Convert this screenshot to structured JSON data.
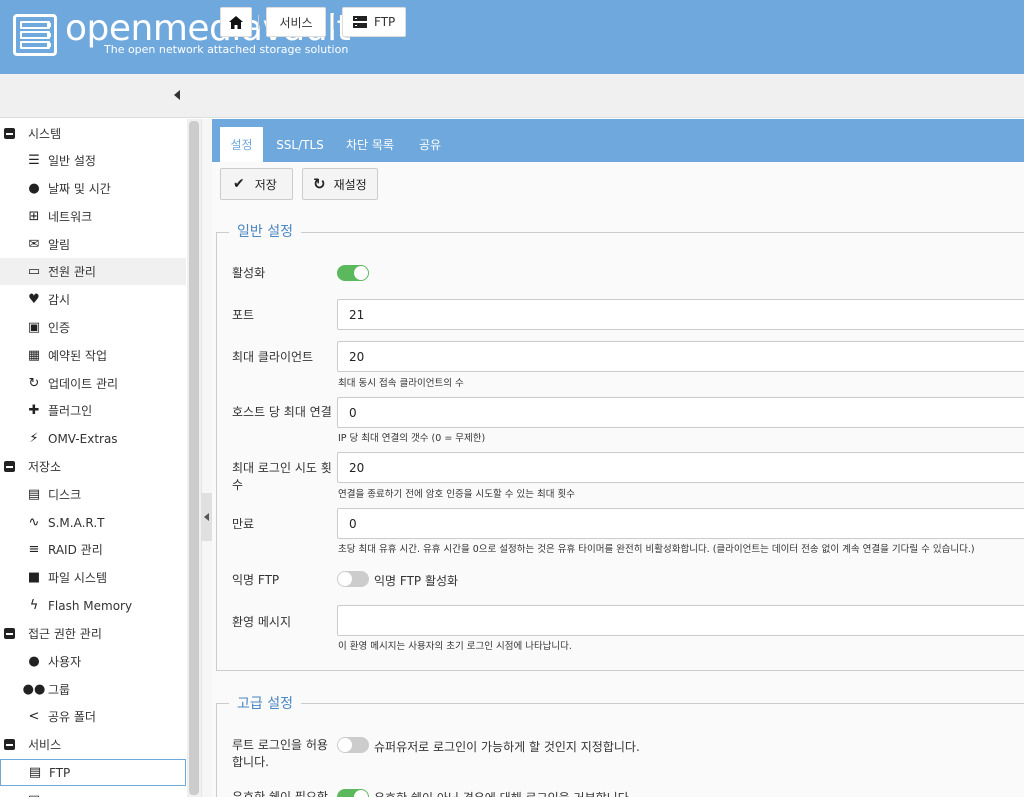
{
  "header": {
    "logo_text": "openmediavault",
    "tagline": "The open network attached storage solution"
  },
  "breadcrumb": {
    "services": "서비스",
    "ftp": "FTP"
  },
  "sidebar": {
    "groups": [
      {
        "label": "시스템"
      },
      {
        "label": "저장소"
      },
      {
        "label": "접근 권한 관리"
      },
      {
        "label": "서비스"
      }
    ],
    "items": [
      {
        "label": "일반 설정",
        "icon": "sliders-icon"
      },
      {
        "label": "날짜 및 시간",
        "icon": "clock-icon"
      },
      {
        "label": "네트워크",
        "icon": "network-icon"
      },
      {
        "label": "알림",
        "icon": "mail-icon"
      },
      {
        "label": "전원 관리",
        "icon": "battery-icon"
      },
      {
        "label": "감시",
        "icon": "heartbeat-icon"
      },
      {
        "label": "인증",
        "icon": "certificate-icon"
      },
      {
        "label": "예약된 작업",
        "icon": "calendar-clock-icon"
      },
      {
        "label": "업데이트 관리",
        "icon": "refresh-icon"
      },
      {
        "label": "플러그인",
        "icon": "puzzle-icon"
      },
      {
        "label": "OMV-Extras",
        "icon": "plug-icon"
      },
      {
        "label": "디스크",
        "icon": "disk-icon"
      },
      {
        "label": "S.M.A.R.T",
        "icon": "pulse-icon"
      },
      {
        "label": "RAID 관리",
        "icon": "database-icon"
      },
      {
        "label": "파일 시스템",
        "icon": "folder-stack-icon"
      },
      {
        "label": "Flash Memory",
        "icon": "lightning-icon"
      },
      {
        "label": "사용자",
        "icon": "user-icon"
      },
      {
        "label": "그룹",
        "icon": "group-icon"
      },
      {
        "label": "공유 폴더",
        "icon": "share-icon"
      },
      {
        "label": "FTP",
        "icon": "server-icon"
      }
    ]
  },
  "tabs": [
    "설정",
    "SSL/TLS",
    "차단 목록",
    "공유"
  ],
  "buttons": {
    "save": "저장",
    "reset": "재설정"
  },
  "general": {
    "legend": "일반 설정",
    "enable_label": "활성화",
    "enable_on": true,
    "port_label": "포트",
    "port_value": "21",
    "max_clients_label": "최대 클라이언트",
    "max_clients_value": "20",
    "max_clients_hint": "최대 동시 접속 클라이언트의 수",
    "max_per_host_label": "호스트 당 최대 연결",
    "max_per_host_value": "0",
    "max_per_host_hint": "IP 당 최대 연결의 갯수 (0 = 무제한)",
    "max_login_label": "최대 로그인 시도 횟수",
    "max_login_value": "20",
    "max_login_hint": "연결을 종료하기 전에 암호 인증을 시도할 수 있는 최대 횟수",
    "timeout_label": "만료",
    "timeout_value": "0",
    "timeout_hint": "초당 최대 유휴 시간. 유휴 시간을 0으로 설정하는 것은 유휴 타이머를 완전히 비활성화합니다. (클라이언트는 데이터 전송 없이 계속 연결을 기다릴 수 있습니다.)",
    "anon_label": "익명 FTP",
    "anon_toggle_label": "익명 FTP 활성화",
    "anon_on": false,
    "welcome_label": "환영 메시지",
    "welcome_value": "",
    "welcome_hint": "이 환영 메시지는 사용자의 초기 로그인 시점에 나타납니다."
  },
  "advanced": {
    "legend": "고급 설정",
    "root_label": "루트 로그인을 허용합니다.",
    "root_toggle_label": "슈퍼유저로 로그인이 가능하게 할 것인지 지정합니다.",
    "root_on": false,
    "shell_label": "유효한 쉘이 필요함",
    "shell_toggle_label": "유효한 쉘이 아닌 경우에 대해 로그인을 거부합니다.",
    "shell_on": true
  }
}
